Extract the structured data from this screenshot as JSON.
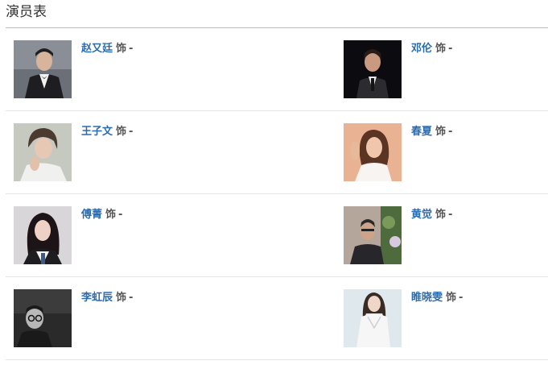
{
  "section": {
    "title": "演员表"
  },
  "cast": [
    {
      "name": "赵又廷",
      "role_label": "饰",
      "role": "-",
      "photo_icon": "actor-photo"
    },
    {
      "name": "邓伦",
      "role_label": "饰",
      "role": "-",
      "photo_icon": "actor-photo"
    },
    {
      "name": "王子文",
      "role_label": "饰",
      "role": "-",
      "photo_icon": "actor-photo"
    },
    {
      "name": "春夏",
      "role_label": "饰",
      "role": "-",
      "photo_icon": "actor-photo"
    },
    {
      "name": "傅菁",
      "role_label": "饰",
      "role": "-",
      "photo_icon": "actor-photo"
    },
    {
      "name": "黄觉",
      "role_label": "饰",
      "role": "-",
      "photo_icon": "actor-photo"
    },
    {
      "name": "李虹辰",
      "role_label": "饰",
      "role": "-",
      "photo_icon": "actor-photo"
    },
    {
      "name": "睢晓雯",
      "role_label": "饰",
      "role": "-",
      "photo_icon": "actor-photo"
    }
  ],
  "colors": {
    "link": "#2b6cb0",
    "text": "#555555",
    "title": "#333333"
  }
}
